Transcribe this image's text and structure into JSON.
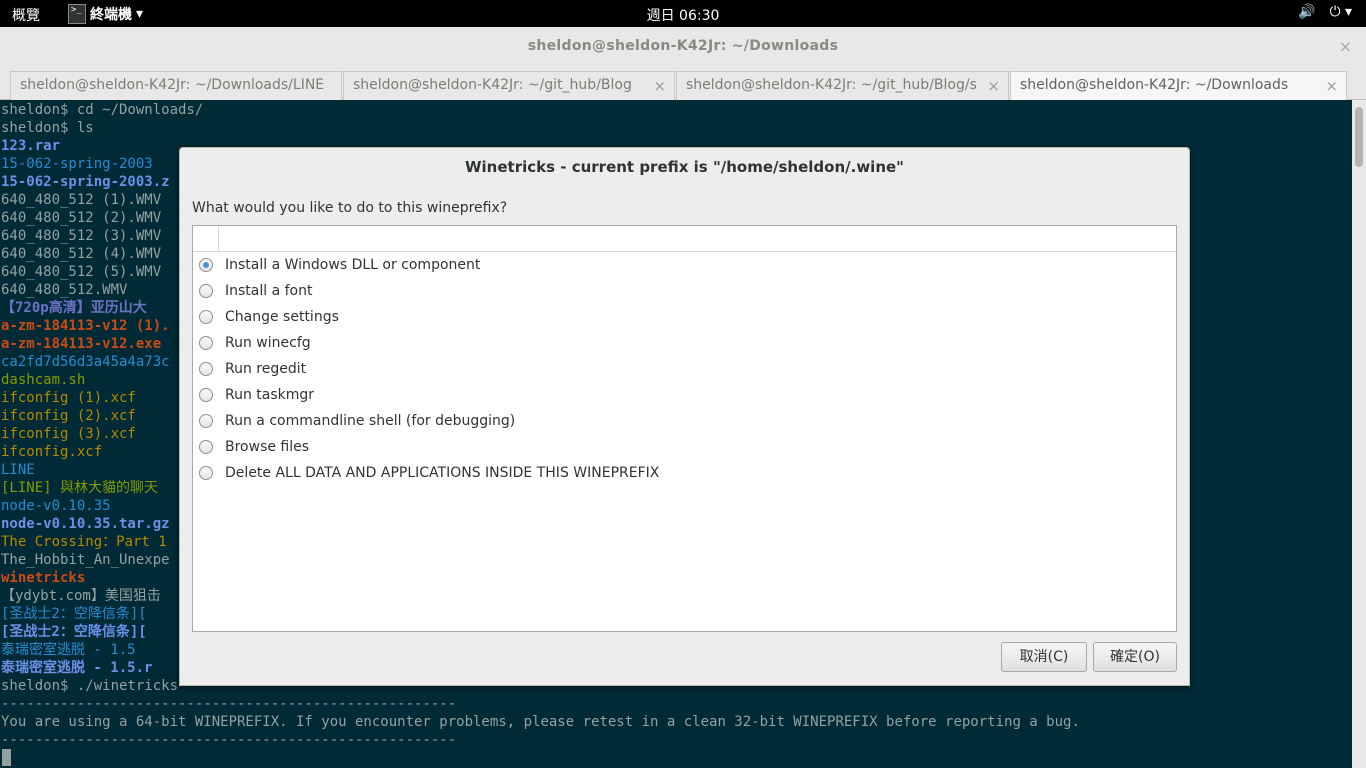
{
  "topbar": {
    "activities": "概覽",
    "app_name": "終端機",
    "app_menu_arrow": "▾",
    "clock": "週日 06:30",
    "volume_icon": "🔊",
    "power_icon": "⏻",
    "power_arrow": "▾"
  },
  "window": {
    "title": "sheldon@sheldon-K42Jr: ~/Downloads",
    "close_glyph": "×"
  },
  "tabs": [
    {
      "label": "sheldon@sheldon-K42Jr: ~/Downloads/LINE"
    },
    {
      "label": "sheldon@sheldon-K42Jr: ~/git_hub/Blog"
    },
    {
      "label": "sheldon@sheldon-K42Jr: ~/git_hub/Blog/s..."
    },
    {
      "label": "sheldon@sheldon-K42Jr: ~/Downloads"
    }
  ],
  "terminal": {
    "lines": [
      {
        "text": "sheldon$ cd ~/Downloads/",
        "style": "c-default"
      },
      {
        "text": "sheldon$ ls",
        "style": "c-default"
      },
      {
        "text": "123.rar",
        "style": "c-bold-blue"
      },
      {
        "text": "15-062-spring-2003",
        "style": "c-blue"
      },
      {
        "text": "15-062-spring-2003.z",
        "style": "c-bold-blue"
      },
      {
        "text": "640_480_512 (1).WMV",
        "style": "c-default"
      },
      {
        "text": "640_480_512 (2).WMV",
        "style": "c-default"
      },
      {
        "text": "640_480_512 (3).WMV",
        "style": "c-default"
      },
      {
        "text": "640_480_512 (4).WMV",
        "style": "c-default"
      },
      {
        "text": "640_480_512 (5).WMV",
        "style": "c-default"
      },
      {
        "text": "640_480_512.WMV",
        "style": "c-default"
      },
      {
        "text": "【720p高清】亚历山大",
        "style": "c-bold-violet"
      },
      {
        "text": "a-zm-184113-v12 (1).",
        "style": "c-bold-orange"
      },
      {
        "text": "a-zm-184113-v12.exe",
        "style": "c-bold-orange"
      },
      {
        "text": "ca2fd7d56d3a45a4a73c",
        "style": "c-blue"
      },
      {
        "text": "dashcam.sh",
        "style": "c-green"
      },
      {
        "text": "ifconfig (1).xcf",
        "style": "c-yellow"
      },
      {
        "text": "ifconfig (2).xcf",
        "style": "c-yellow"
      },
      {
        "text": "ifconfig (3).xcf",
        "style": "c-yellow"
      },
      {
        "text": "ifconfig.xcf",
        "style": "c-yellow"
      },
      {
        "text": "LINE",
        "style": "c-blue"
      },
      {
        "text": "[LINE] 與林大貓的聊天",
        "style": "c-green"
      },
      {
        "text": "node-v0.10.35",
        "style": "c-blue"
      },
      {
        "text": "node-v0.10.35.tar.gz",
        "style": "c-bold-blue"
      },
      {
        "text": "The Crossing：Part 1",
        "style": "c-yellow"
      },
      {
        "text": "The_Hobbit_An_Unexpe",
        "style": "c-default"
      },
      {
        "text": "winetricks",
        "style": "c-bold-orange"
      },
      {
        "text": "【ydybt.com】美国狙击",
        "style": "c-default"
      },
      {
        "text": "[圣战士2：空降信条][",
        "style": "c-blue"
      },
      {
        "text": "[圣战士2：空降信条][",
        "style": "c-bold-blue"
      },
      {
        "text": "泰瑞密室逃脱 - 1.5",
        "style": "c-blue"
      },
      {
        "text": "泰瑞密室逃脱 - 1.5.r",
        "style": "c-bold-blue"
      },
      {
        "text": "sheldon$ ./winetricks",
        "style": "c-default"
      },
      {
        "text": "------------------------------------------------------",
        "style": "c-default"
      },
      {
        "text": "You are using a 64-bit WINEPREFIX. If you encounter problems, please retest in a clean 32-bit WINEPREFIX before reporting a bug.",
        "style": "c-default"
      },
      {
        "text": "------------------------------------------------------",
        "style": "c-default"
      }
    ]
  },
  "dialog": {
    "title": "Winetricks - current prefix is \"/home/sheldon/.wine\"",
    "prompt": "What would you like to do to this wineprefix?",
    "options": [
      {
        "label": "Install a Windows DLL or component",
        "checked": true
      },
      {
        "label": "Install a font",
        "checked": false
      },
      {
        "label": "Change settings",
        "checked": false
      },
      {
        "label": "Run winecfg",
        "checked": false
      },
      {
        "label": "Run regedit",
        "checked": false
      },
      {
        "label": "Run taskmgr",
        "checked": false
      },
      {
        "label": "Run a commandline shell (for debugging)",
        "checked": false
      },
      {
        "label": "Browse files",
        "checked": false
      },
      {
        "label": "Delete ALL DATA AND APPLICATIONS INSIDE THIS WINEPREFIX",
        "checked": false
      }
    ],
    "cancel_label": "取消(C)",
    "ok_label": "確定(O)"
  }
}
